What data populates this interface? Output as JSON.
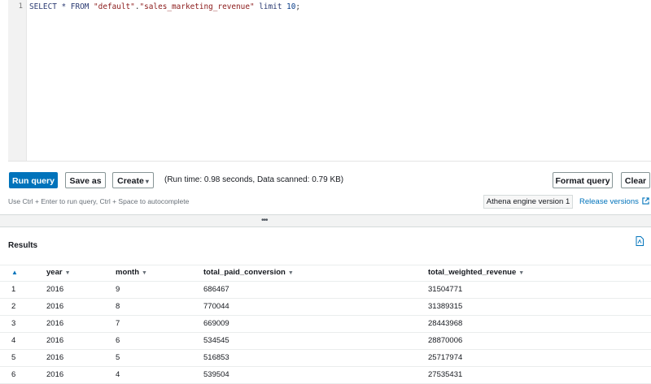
{
  "editor": {
    "line_number": "1",
    "code": {
      "select": "SELECT * FROM ",
      "db": "\"default\"",
      "dot": ".",
      "table": "\"sales_marketing_revenue\"",
      "limit": " limit ",
      "limit_value": "10",
      "semi": ";"
    }
  },
  "toolbar": {
    "run_label": "Run query",
    "save_label": "Save as",
    "create_label": "Create",
    "run_info": "(Run time: 0.98 seconds, Data scanned: 0.79 KB)",
    "format_label": "Format query",
    "clear_label": "Clear",
    "hint": "Use Ctrl + Enter to run query, Ctrl + Space to autocomplete",
    "engine_label": "Athena engine version 1",
    "release_label": "Release versions"
  },
  "splitter": {
    "grip": "•••"
  },
  "results": {
    "title": "Results",
    "columns": [
      "year",
      "month",
      "total_paid_conversion",
      "total_weighted_revenue"
    ],
    "rows": [
      [
        "1",
        "2016",
        "9",
        "686467",
        "31504771"
      ],
      [
        "2",
        "2016",
        "8",
        "770044",
        "31389315"
      ],
      [
        "3",
        "2016",
        "7",
        "669009",
        "28443968"
      ],
      [
        "4",
        "2016",
        "6",
        "534545",
        "28870006"
      ],
      [
        "5",
        "2016",
        "5",
        "516853",
        "25717974"
      ],
      [
        "6",
        "2016",
        "4",
        "539504",
        "27535431"
      ]
    ]
  },
  "icons": {
    "external": "external-link-icon",
    "download": "download-icon",
    "sort": "sort-down-icon",
    "sort_up": "sort-up-icon"
  },
  "colors": {
    "primary": "#0073bb",
    "link": "#0073bb",
    "border": "#879596"
  }
}
